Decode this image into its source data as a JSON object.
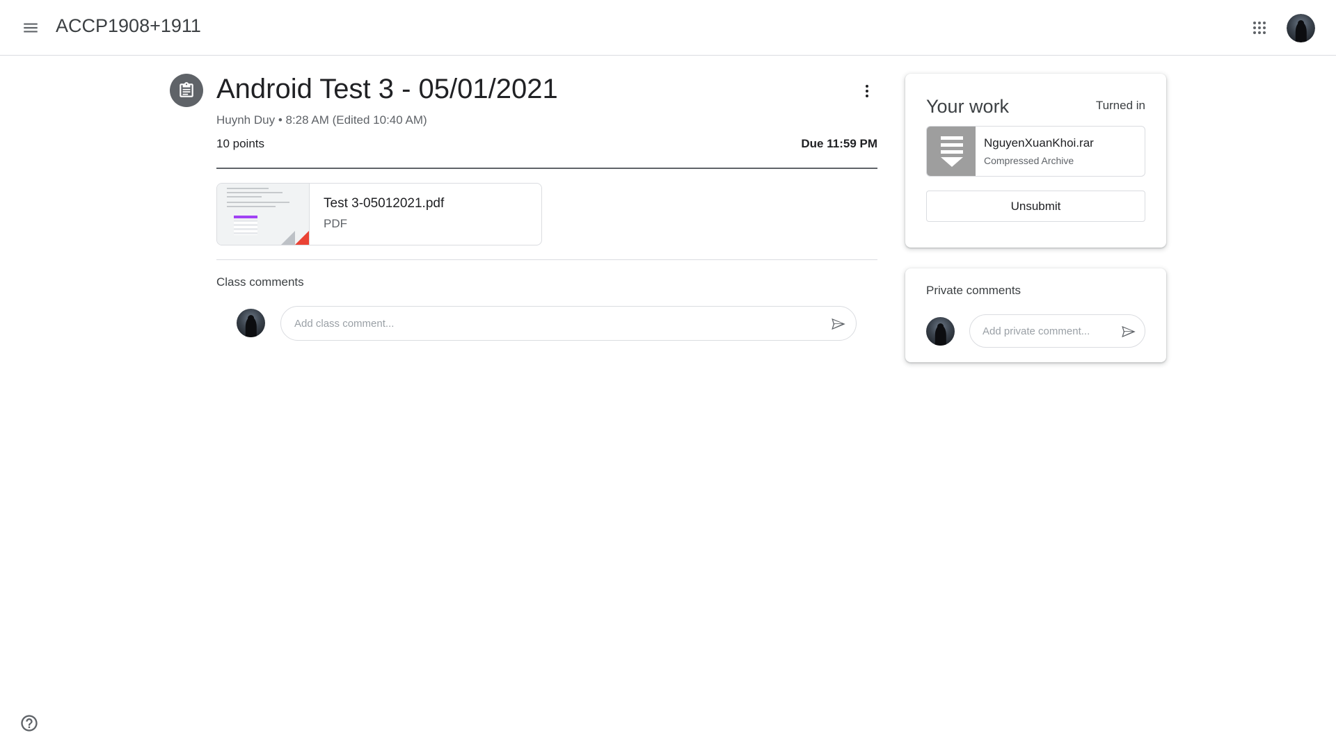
{
  "header": {
    "class_name": "ACCP1908+1911",
    "icons": {
      "menu": "hamburger-menu-icon",
      "apps": "google-apps-icon",
      "account": "account-avatar"
    }
  },
  "assignment": {
    "title": "Android Test 3 - 05/01/2021",
    "meta": "Huynh Duy • 8:28 AM (Edited 10:40 AM)",
    "points": "10 points",
    "due": "Due 11:59 PM",
    "attachment": {
      "name": "Test 3-05012021.pdf",
      "type": "PDF"
    }
  },
  "class_comments": {
    "label": "Class comments",
    "placeholder": "Add class comment..."
  },
  "your_work": {
    "title": "Your work",
    "status": "Turned in",
    "file": {
      "name": "NguyenXuanKhoi.rar",
      "type": "Compressed Archive"
    },
    "unsubmit_label": "Unsubmit"
  },
  "private_comments": {
    "label": "Private comments",
    "placeholder": "Add private comment..."
  },
  "colors": {
    "icon_grey": "#5f6368",
    "border": "#dadce0",
    "pdf_red": "#ea4335"
  }
}
